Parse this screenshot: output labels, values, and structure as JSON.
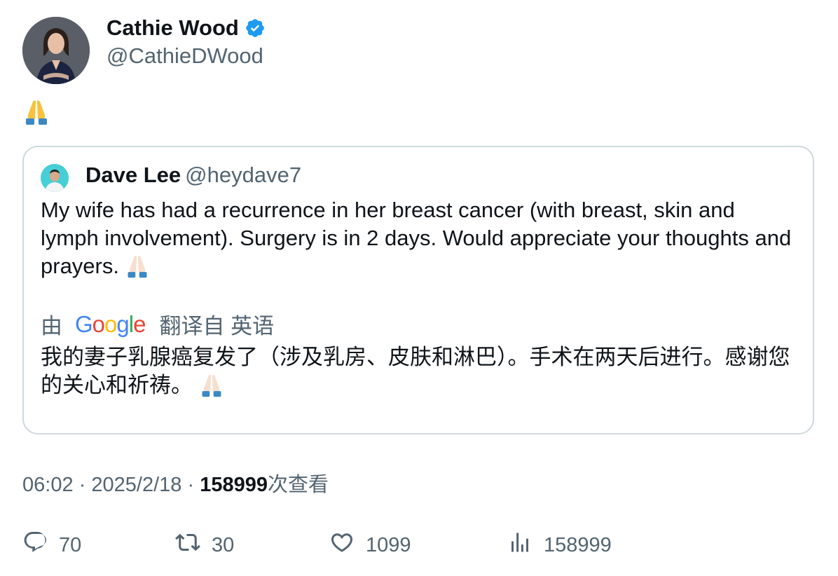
{
  "author": {
    "name": "Cathie Wood",
    "handle": "@CathieDWood",
    "avatar_icon": "person-photo-avatar",
    "verified_icon": "verified-badge-icon"
  },
  "tweet": {
    "emoji_icon": "folded-hands-emoji"
  },
  "quoted": {
    "name": "Dave Lee",
    "handle": "@heydave7",
    "text": "My wife has had a recurrence in her breast cancer (with breast, skin and lymph involvement). Surgery is in 2 days. Would appreciate your thoughts and prayers.",
    "translation": {
      "prefix": "由",
      "provider_logo": "Google",
      "suffix": "翻译自 英语",
      "text": "我的妻子乳腺癌复发了（涉及乳房、皮肤和淋巴）。手术在两天后进行。感谢您的关心和祈祷。"
    }
  },
  "meta": {
    "time": "06:02",
    "sep1": "·",
    "date": "2025/2/18",
    "sep2": "·",
    "views": "158999",
    "views_label": "次查看"
  },
  "actions": {
    "replies": "70",
    "retweets": "30",
    "likes": "1099",
    "views": "158999"
  },
  "colors": {
    "text_primary": "#0f1419",
    "text_secondary": "#536471",
    "border": "#cfd9de",
    "verified": "#1d9bf0"
  }
}
